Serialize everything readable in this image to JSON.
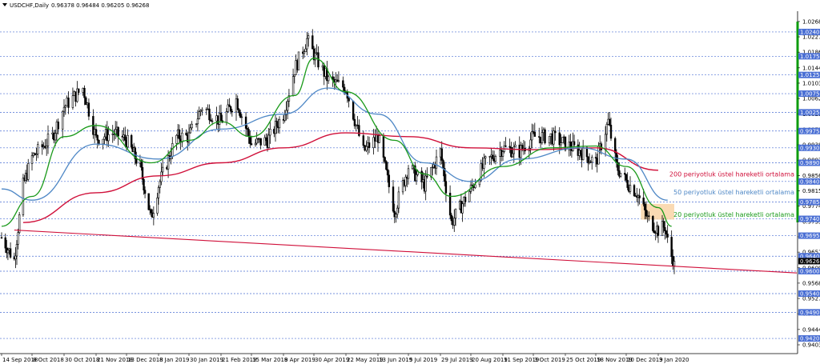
{
  "header": {
    "symbol": "USDCHF,Daily",
    "ohlc": "0.96378 0.96484 0.96205 0.96268"
  },
  "colors": {
    "background": "#ffffff",
    "grid": "#4a6fd4",
    "candle": "#000000",
    "ema20": "#1a9a1a",
    "ema50": "#4f88c6",
    "ema200": "#d0103a",
    "trendline": "#d0103a",
    "zone": "#f9d3a6",
    "level_label_bg": "#4a6fd4",
    "price_label_bg": "#000000",
    "range_bar": "#0e9c0e"
  },
  "chart_data": {
    "type": "candlestick",
    "instrument": "USDCHF",
    "timeframe": "Daily",
    "last_price": 0.96268,
    "ylim": [
      0.9403,
      1.0287
    ],
    "y_ticks": [
      "1.02680",
      "1.02270",
      "1.01860",
      "1.01440",
      "1.01030",
      "1.00620",
      "1.00210",
      "0.99790",
      "0.99380",
      "0.98970",
      "0.98560",
      "0.98150",
      "0.97740",
      "0.97330",
      "0.96920",
      "0.96510",
      "0.96090",
      "0.95680",
      "0.95270",
      "0.94860",
      "0.94440",
      "0.94030"
    ],
    "x_ticks": [
      "14 Sep 2018",
      "8 Oct 2018",
      "30 Oct 2018",
      "21 Nov 2018",
      "13 Dec 2018",
      "8 Jan 2019",
      "30 Jan 2019",
      "21 Feb 2019",
      "15 Mar 2019",
      "8 Apr 2019",
      "30 Apr 2019",
      "22 May 2019",
      "13 Jun 2019",
      "5 Jul 2019",
      "29 Jul 2019",
      "20 Aug 2019",
      "11 Sep 2019",
      "3 Oct 2019",
      "25 Oct 2019",
      "18 Nov 2019",
      "10 Dec 2019",
      "3 Jan 2020"
    ],
    "levels": [
      {
        "label": "1.02400",
        "value": 1.024
      },
      {
        "label": "1.01750",
        "value": 1.0175
      },
      {
        "label": "1.01250",
        "value": 1.0125
      },
      {
        "label": "1.00750",
        "value": 1.0075
      },
      {
        "label": "1.00250",
        "value": 1.0025
      },
      {
        "label": "0.99750",
        "value": 0.9975
      },
      {
        "label": "0.99300",
        "value": 0.993
      },
      {
        "label": "0.98900",
        "value": 0.989
      },
      {
        "label": "0.98400",
        "value": 0.984
      },
      {
        "label": "0.97850",
        "value": 0.9785
      },
      {
        "label": "0.97400",
        "value": 0.974
      },
      {
        "label": "0.96950",
        "value": 0.9695
      },
      {
        "label": "0.96400",
        "value": 0.964
      },
      {
        "label": "0.96000",
        "value": 0.96
      },
      {
        "label": "0.95400",
        "value": 0.954
      },
      {
        "label": "0.94900",
        "value": 0.949
      },
      {
        "label": "0.94200",
        "value": 0.942
      }
    ],
    "price_series": [
      {
        "date": "2018-09-14",
        "close": 0.969
      },
      {
        "date": "2018-09-24",
        "close": 0.963
      },
      {
        "date": "2018-10-01",
        "close": 0.983
      },
      {
        "date": "2018-10-08",
        "close": 0.9905
      },
      {
        "date": "2018-10-22",
        "close": 0.996
      },
      {
        "date": "2018-10-30",
        "close": 1.004
      },
      {
        "date": "2018-11-12",
        "close": 1.009
      },
      {
        "date": "2018-11-21",
        "close": 0.9955
      },
      {
        "date": "2018-12-04",
        "close": 0.997
      },
      {
        "date": "2018-12-13",
        "close": 0.995
      },
      {
        "date": "2018-12-24",
        "close": 0.988
      },
      {
        "date": "2019-01-02",
        "close": 0.974
      },
      {
        "date": "2019-01-08",
        "close": 0.983
      },
      {
        "date": "2019-01-21",
        "close": 0.996
      },
      {
        "date": "2019-01-30",
        "close": 0.996
      },
      {
        "date": "2019-02-08",
        "close": 1.004
      },
      {
        "date": "2019-02-21",
        "close": 1.0
      },
      {
        "date": "2019-03-04",
        "close": 1.006
      },
      {
        "date": "2019-03-15",
        "close": 0.994
      },
      {
        "date": "2019-03-27",
        "close": 0.995
      },
      {
        "date": "2019-04-08",
        "close": 1.002
      },
      {
        "date": "2019-04-16",
        "close": 1.014
      },
      {
        "date": "2019-04-25",
        "close": 1.022
      },
      {
        "date": "2019-04-30",
        "close": 1.018
      },
      {
        "date": "2019-05-10",
        "close": 1.011
      },
      {
        "date": "2019-05-22",
        "close": 1.009
      },
      {
        "date": "2019-06-03",
        "close": 0.992
      },
      {
        "date": "2019-06-13",
        "close": 0.996
      },
      {
        "date": "2019-06-25",
        "close": 0.976
      },
      {
        "date": "2019-07-05",
        "close": 0.988
      },
      {
        "date": "2019-07-17",
        "close": 0.983
      },
      {
        "date": "2019-07-29",
        "close": 0.992
      },
      {
        "date": "2019-08-06",
        "close": 0.973
      },
      {
        "date": "2019-08-20",
        "close": 0.982
      },
      {
        "date": "2019-08-30",
        "close": 0.989
      },
      {
        "date": "2019-09-11",
        "close": 0.993
      },
      {
        "date": "2019-09-23",
        "close": 0.992
      },
      {
        "date": "2019-10-03",
        "close": 0.996
      },
      {
        "date": "2019-10-15",
        "close": 0.996
      },
      {
        "date": "2019-10-25",
        "close": 0.994
      },
      {
        "date": "2019-11-06",
        "close": 0.992
      },
      {
        "date": "2019-11-18",
        "close": 0.989
      },
      {
        "date": "2019-11-27",
        "close": 1.0
      },
      {
        "date": "2019-12-03",
        "close": 0.988
      },
      {
        "date": "2019-12-10",
        "close": 0.984
      },
      {
        "date": "2019-12-18",
        "close": 0.981
      },
      {
        "date": "2019-12-26",
        "close": 0.974
      },
      {
        "date": "2020-01-03",
        "close": 0.971
      },
      {
        "date": "2020-01-08",
        "close": 0.972
      },
      {
        "date": "2020-01-10",
        "close": 0.968
      },
      {
        "date": "2020-01-13",
        "close": 0.964
      },
      {
        "date": "2020-01-15",
        "close": 0.96268
      }
    ],
    "ema200_series": [
      {
        "date": "2018-10-01",
        "value": 0.973
      },
      {
        "date": "2018-11-21",
        "value": 0.981
      },
      {
        "date": "2019-01-08",
        "value": 0.9855
      },
      {
        "date": "2019-02-21",
        "value": 0.989
      },
      {
        "date": "2019-04-08",
        "value": 0.993
      },
      {
        "date": "2019-05-22",
        "value": 0.997
      },
      {
        "date": "2019-07-05",
        "value": 0.996
      },
      {
        "date": "2019-08-20",
        "value": 0.993
      },
      {
        "date": "2019-10-03",
        "value": 0.9925
      },
      {
        "date": "2019-11-18",
        "value": 0.993
      },
      {
        "date": "2020-01-03",
        "value": 0.987
      }
    ],
    "ema50_series": [
      {
        "date": "2018-09-14",
        "value": 0.982
      },
      {
        "date": "2018-10-08",
        "value": 0.979
      },
      {
        "date": "2018-11-21",
        "value": 0.994
      },
      {
        "date": "2019-01-08",
        "value": 0.99
      },
      {
        "date": "2019-02-21",
        "value": 0.998
      },
      {
        "date": "2019-04-08",
        "value": 1.002
      },
      {
        "date": "2019-05-10",
        "value": 1.009
      },
      {
        "date": "2019-06-13",
        "value": 1.002
      },
      {
        "date": "2019-07-17",
        "value": 0.989
      },
      {
        "date": "2019-08-20",
        "value": 0.984
      },
      {
        "date": "2019-09-23",
        "value": 0.99
      },
      {
        "date": "2019-11-06",
        "value": 0.993
      },
      {
        "date": "2019-12-10",
        "value": 0.99
      },
      {
        "date": "2020-01-10",
        "value": 0.979
      }
    ],
    "ema20_series": [
      {
        "date": "2018-09-14",
        "value": 0.972
      },
      {
        "date": "2018-10-08",
        "value": 0.98
      },
      {
        "date": "2018-10-30",
        "value": 0.996
      },
      {
        "date": "2018-11-21",
        "value": 0.999
      },
      {
        "date": "2019-01-02",
        "value": 0.989
      },
      {
        "date": "2019-01-30",
        "value": 0.995
      },
      {
        "date": "2019-02-21",
        "value": 1.0
      },
      {
        "date": "2019-03-15",
        "value": 0.996
      },
      {
        "date": "2019-04-16",
        "value": 1.007
      },
      {
        "date": "2019-04-30",
        "value": 1.017
      },
      {
        "date": "2019-05-22",
        "value": 1.008
      },
      {
        "date": "2019-06-25",
        "value": 0.995
      },
      {
        "date": "2019-07-17",
        "value": 0.986
      },
      {
        "date": "2019-08-06",
        "value": 0.98
      },
      {
        "date": "2019-09-11",
        "value": 0.988
      },
      {
        "date": "2019-10-15",
        "value": 0.993
      },
      {
        "date": "2019-11-18",
        "value": 0.9935
      },
      {
        "date": "2019-12-10",
        "value": 0.988
      },
      {
        "date": "2020-01-03",
        "value": 0.977
      },
      {
        "date": "2020-01-13",
        "value": 0.972
      }
    ],
    "trendline": {
      "from": {
        "date": "2018-09-24",
        "value": 0.971
      },
      "to": {
        "date": "2020-01-31",
        "value": 0.961
      }
    },
    "zone": {
      "from_date": "2019-12-21",
      "to_date": "2020-01-15",
      "top": 0.978,
      "bottom": 0.9738
    },
    "annotations": [
      {
        "text": "200 periyotluk üstel hareketli ortalama",
        "color": "#d0103a",
        "y": 0.986
      },
      {
        "text": "50 periyotluk üstel hareketli ortalama",
        "color": "#4f88c6",
        "y": 0.9812
      },
      {
        "text": "20 periyotluk üstel hareketli ortalama",
        "color": "#1a9a1a",
        "y": 0.9752
      }
    ]
  }
}
